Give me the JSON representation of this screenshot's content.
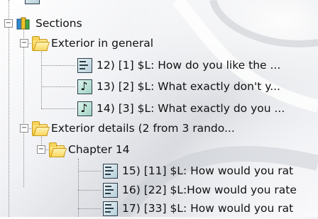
{
  "tree": {
    "sections": {
      "label": "Sections",
      "expander": "−",
      "icon": "books-icon",
      "groups": [
        {
          "label": "Exterior in general",
          "expander": "−",
          "icon": "open-folder-icon",
          "items": [
            {
              "label": "12) [1] $L: How do you like the ...",
              "icon": "text-question-icon"
            },
            {
              "label": "13) [2] $L: What exactly don't y...",
              "icon": "music-note-icon"
            },
            {
              "label": "14) [3] $L: What exactly do you ...",
              "icon": "music-note-icon"
            }
          ]
        },
        {
          "label": "Exterior details (2 from 3 rando...",
          "expander": "−",
          "icon": "open-folder-icon",
          "subgroups": [
            {
              "label": "Chapter 14",
              "expander": "−",
              "icon": "open-folder-icon",
              "items": [
                {
                  "label": "15) [11] $L: How would you rat",
                  "icon": "text-question-icon"
                },
                {
                  "label": "16) [22] $L:How would you rate",
                  "icon": "text-question-icon"
                },
                {
                  "label": "17) [33] $L: How would you rat",
                  "icon": "text-question-icon"
                }
              ]
            }
          ]
        }
      ]
    }
  }
}
